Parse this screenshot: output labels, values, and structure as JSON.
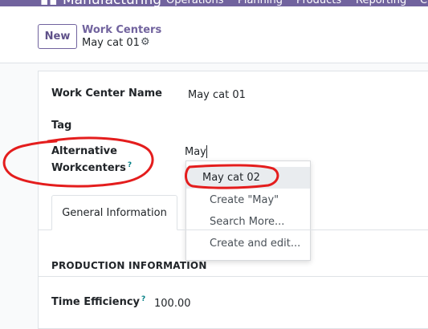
{
  "topbar": {
    "app_name": "Manufacturing",
    "menu": [
      "Operations",
      "Planning",
      "Products",
      "Reporting",
      "C"
    ]
  },
  "control_panel": {
    "new_label": "New",
    "breadcrumb": "Work Centers",
    "record_name": "May cat 01"
  },
  "form": {
    "work_center_name_label": "Work Center Name",
    "work_center_name_value": "May cat 01",
    "tag_label": "Tag",
    "alt_label_line1": "Alternative",
    "alt_label_line2": "Workcenters",
    "help_mark": "?",
    "alt_input_value": "May",
    "dropdown": [
      "May cat 02",
      "Create \"May\"",
      "Search More...",
      "Create and edit..."
    ],
    "tabs": [
      "General Information"
    ],
    "section_title": "PRODUCTION INFORMATION",
    "time_efficiency_label": "Time Efficiency",
    "time_efficiency_value": "100.00"
  },
  "colors": {
    "brand": "#71639e",
    "annotation": "#e41d1d"
  }
}
